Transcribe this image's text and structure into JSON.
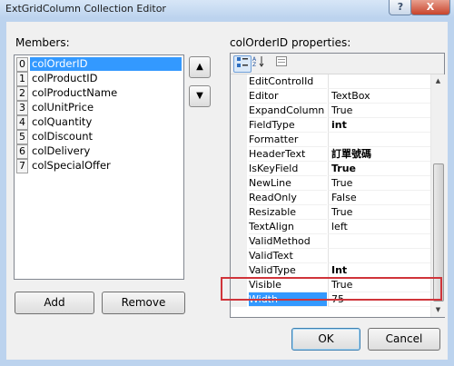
{
  "window": {
    "title": "ExtGridColumn Collection Editor",
    "help_glyph": "?",
    "close_glyph": "X"
  },
  "members": {
    "label": "Members:",
    "items": [
      {
        "index": "0",
        "name": "colOrderID"
      },
      {
        "index": "1",
        "name": "colProductID"
      },
      {
        "index": "2",
        "name": "colProductName"
      },
      {
        "index": "3",
        "name": "colUnitPrice"
      },
      {
        "index": "4",
        "name": "colQuantity"
      },
      {
        "index": "5",
        "name": "colDiscount"
      },
      {
        "index": "6",
        "name": "colDelivery"
      },
      {
        "index": "7",
        "name": "colSpecialOffer"
      }
    ],
    "selected_index": 0,
    "move_up_glyph": "▲",
    "move_down_glyph": "▼",
    "add_label": "Add",
    "remove_label": "Remove"
  },
  "properties": {
    "label": "colOrderID properties:",
    "toolbar": {
      "categorized_icon": "categorized-icon",
      "alphabetical_icon": "alphabetical-icon",
      "pages_icon": "property-pages-icon"
    },
    "rows": [
      {
        "name": "EditControlId",
        "value": "",
        "bold": false
      },
      {
        "name": "Editor",
        "value": "TextBox",
        "bold": false
      },
      {
        "name": "ExpandColumn",
        "value": "True",
        "bold": false
      },
      {
        "name": "FieldType",
        "value": "int",
        "bold": true
      },
      {
        "name": "Formatter",
        "value": "",
        "bold": false
      },
      {
        "name": "HeaderText",
        "value": "訂單號碼",
        "bold": true
      },
      {
        "name": "IsKeyField",
        "value": "True",
        "bold": true
      },
      {
        "name": "NewLine",
        "value": "True",
        "bold": false
      },
      {
        "name": "ReadOnly",
        "value": "False",
        "bold": false
      },
      {
        "name": "Resizable",
        "value": "True",
        "bold": false
      },
      {
        "name": "TextAlign",
        "value": "left",
        "bold": false
      },
      {
        "name": "ValidMethod",
        "value": "",
        "bold": false
      },
      {
        "name": "ValidText",
        "value": "",
        "bold": false
      },
      {
        "name": "ValidType",
        "value": "Int",
        "bold": true
      },
      {
        "name": "Visible",
        "value": "True",
        "bold": false
      },
      {
        "name": "Width",
        "value": "75",
        "bold": false
      }
    ],
    "selected_row": "Width",
    "highlight_color": "#d0343a"
  },
  "footer": {
    "ok_label": "OK",
    "cancel_label": "Cancel"
  }
}
